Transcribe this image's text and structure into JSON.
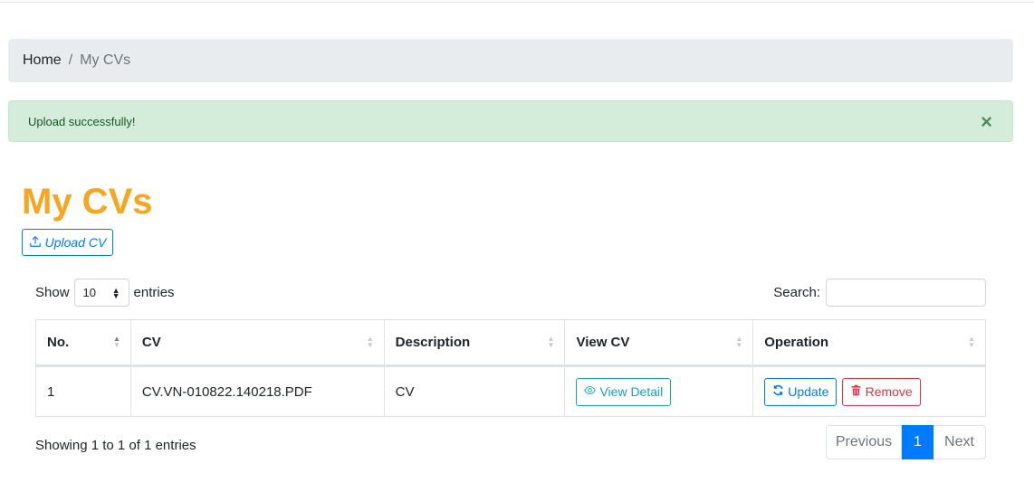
{
  "breadcrumb": {
    "home": "Home",
    "separator": "/",
    "current": "My CVs"
  },
  "alert": {
    "message": "Upload successfully!",
    "close_symbol": "×"
  },
  "page": {
    "title": "My CVs",
    "upload_label": "Upload CV"
  },
  "table_controls": {
    "show_label": "Show",
    "page_length": "10",
    "entries_label": "entries",
    "search_label": "Search:",
    "search_value": ""
  },
  "table": {
    "columns": [
      "No.",
      "CV",
      "Description",
      "View CV",
      "Operation"
    ],
    "rows": [
      {
        "no": "1",
        "cv": "CV.VN-010822.140218.PDF",
        "description": "CV",
        "view_label": "View Detail",
        "update_label": "Update",
        "remove_label": "Remove"
      }
    ]
  },
  "footer": {
    "info": "Showing 1 to 1 of 1 entries",
    "previous": "Previous",
    "current_page": "1",
    "next": "Next"
  },
  "colors": {
    "title": "#f5a623",
    "primary": "#007bff",
    "info": "#17a2b8",
    "danger": "#dc3545",
    "success_bg": "#d4edda"
  },
  "icons": {
    "upload": "upload-icon",
    "view": "eye-icon",
    "update": "refresh-icon",
    "remove": "trash-icon",
    "close": "close-icon"
  }
}
